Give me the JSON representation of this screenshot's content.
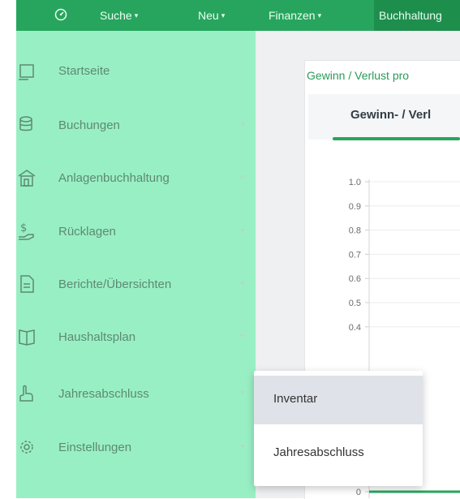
{
  "topnav": {
    "dashboard_icon": "gauge-icon",
    "items": [
      {
        "label": "Suche",
        "caret": "▾"
      },
      {
        "label": "Neu",
        "caret": "▾"
      },
      {
        "label": "Finanzen",
        "caret": "▾"
      }
    ],
    "active_label": "Buchhaltung"
  },
  "sidebar": {
    "items": [
      {
        "label": "Startseite",
        "icon": "monitor-icon"
      },
      {
        "label": "Buchungen",
        "icon": "coins-icon"
      },
      {
        "label": "Anlagenbuchhaltung",
        "icon": "building-icon"
      },
      {
        "label": "Rücklagen",
        "icon": "money-hand-icon"
      },
      {
        "label": "Berichte/Übersichten",
        "icon": "report-icon"
      },
      {
        "label": "Haushaltsplan",
        "icon": "book-icon"
      },
      {
        "label": "Jahresabschluss",
        "icon": "hand-icon"
      },
      {
        "label": "Einstellungen",
        "icon": "gear-icon"
      }
    ]
  },
  "main": {
    "panel_title": "Gewinn / Verlust pro",
    "tab_label": "Gewinn- / Verl"
  },
  "chart_data": {
    "type": "line",
    "y_ticks": [
      "1.0",
      "0.9",
      "0.8",
      "0.7",
      "0.6",
      "0.5",
      "0.4",
      "0"
    ],
    "ylim": [
      0,
      1.0
    ],
    "grid": true
  },
  "dropdown": {
    "items": [
      {
        "label": "Inventar"
      },
      {
        "label": "Jahresabschluss"
      }
    ]
  },
  "colors": {
    "topbar": "#27a55e",
    "sidebar": "#99efc4",
    "accent": "#27a55e"
  }
}
